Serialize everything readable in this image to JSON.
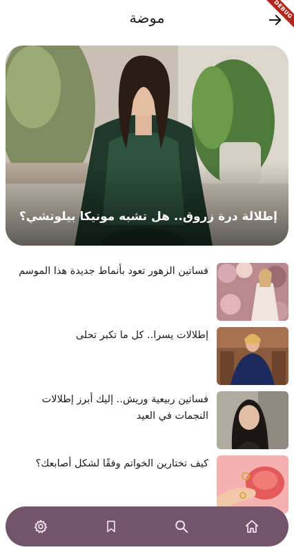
{
  "app_bar": {
    "title": "موضة",
    "back_icon": "arrow-right-icon",
    "debug_banner": "DEBUG"
  },
  "featured": {
    "title": "إطلالة درة زروق.. هل تشبه مونيكا بيلوتشي؟",
    "image": "woman-embroidered-dress-photo"
  },
  "articles": [
    {
      "title": "فساتين الزهور تعود بأنماط جديدة هذا الموسم",
      "image": "floral-dress-photo"
    },
    {
      "title": "إطلالات يسرا.. كل ما تكبر تحلى",
      "image": "blue-gown-photo"
    },
    {
      "title": "فساتين ربيعية وريش.. إليك أبرز إطلالات النجمات في العيد",
      "image": "dark-hair-portrait-photo"
    },
    {
      "title": "كيف تختارين الخواتم وفقًا لشكل أصابعك؟",
      "image": "hand-rings-photo"
    }
  ],
  "bottom_nav": {
    "items": [
      {
        "icon": "gear-icon",
        "name": "settings"
      },
      {
        "icon": "bookmark-icon",
        "name": "bookmarks"
      },
      {
        "icon": "search-icon",
        "name": "search"
      },
      {
        "icon": "home-icon",
        "name": "home"
      }
    ],
    "background": "#74546a",
    "icon_color": "#f2e3ec"
  }
}
